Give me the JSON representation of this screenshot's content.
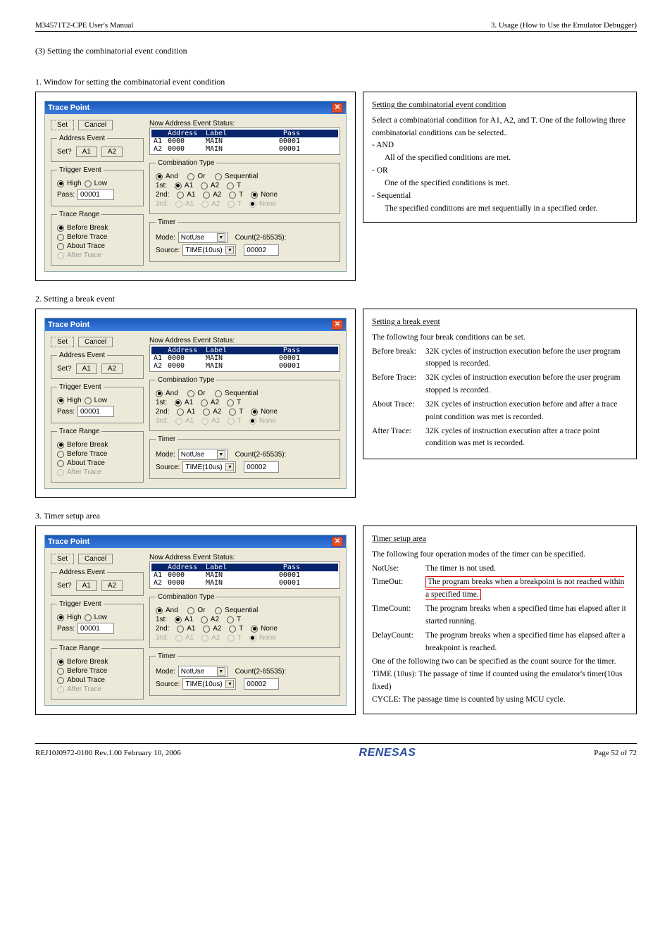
{
  "header": {
    "left": "M34571T2-CPE User's Manual",
    "right": "3. Usage (How to Use the Emulator Debugger)"
  },
  "sect3": "(3) Setting the combinatorial event condition",
  "step1": "1. Window for setting the combinatorial event condition",
  "step2": "2. Setting a break event",
  "step3": "3. Timer setup area",
  "dlg": {
    "title": "Trace Point",
    "set": "Set",
    "cancel": "Cancel",
    "addr_event": "Address Event",
    "setq": "Set?",
    "a1": "A1",
    "a2": "A2",
    "now_status": "Now Address Event Status:",
    "tbl_hdr_addr": "Address",
    "tbl_hdr_lbl": "Label",
    "tbl_hdr_pass": "Pass",
    "rows": [
      {
        "idx": "A1",
        "addr": "0000",
        "lbl": "MAIN",
        "pass": "00001"
      },
      {
        "idx": "A2",
        "addr": "0000",
        "lbl": "MAIN",
        "pass": "00001"
      }
    ],
    "trig_event": "Trigger Event",
    "high": "High",
    "low": "Low",
    "pass": "Pass:",
    "pass_val": "00001",
    "trace_range": "Trace Range",
    "tr_bb": "Before Break",
    "tr_bt": "Before Trace",
    "tr_at": "About Trace",
    "tr_af": "After Trace",
    "combo_type": "Combination Type",
    "and": "And",
    "or": "Or",
    "seq": "Sequential",
    "first": "1st:",
    "second": "2nd:",
    "third": "3rd:",
    "none": "None",
    "t": "T",
    "timer": "Timer",
    "mode": "Mode:",
    "mode_val": "NotUse",
    "count": "Count(2-65535):",
    "source": "Source:",
    "source_val": "TIME(10us)",
    "count_val": "00002"
  },
  "call1": {
    "title": "Setting the combinatorial event condition",
    "para1": "Select a combinatorial condition for A1, A2, and T. One of the following three combinatorial conditions can be selected..",
    "and": "AND",
    "and_d": "All of the specified conditions are met.",
    "or": "OR",
    "or_d": "One of the specified conditions is met.",
    "seq": "Sequential",
    "seq_d": "The specified conditions are met sequentially in a specified order."
  },
  "call2": {
    "title": "Setting a break event",
    "para": "The following four break conditions can be set.",
    "bb_k": "Before break:",
    "bb_v": "32K cycles of instruction execution before the user program stopped is recorded.",
    "bt_k": "Before Trace:",
    "bt_v": "32K cycles of instruction execution before the user program stopped is recorded.",
    "at_k": "About Trace:",
    "at_v": "32K cycles of instruction execution before and after a trace point condition was met is recorded.",
    "af_k": "After Trace:",
    "af_v": "32K cycles of instruction execution after a trace point condition was met is recorded."
  },
  "call3": {
    "title": "Timer setup area",
    "para": "The following four operation modes of the timer can be specified.",
    "nu_k": "NotUse:",
    "nu_v": "The timer is not used.",
    "to_k": "TimeOut:",
    "to_v": "The program breaks when a breakpoint is not reached within a specified time.",
    "tc_k": "TimeCount:",
    "tc_v": "The program breaks when a specified time has elapsed after it started running.",
    "dc_k": "DelayCount:",
    "dc_v": "The program breaks when a specified time has elapsed after a breakpoint is reached.",
    "after": "One of the following two can be specified as the count source for the timer.",
    "time_l": "TIME (10us): The passage of time if counted using the emulator's timer(10us fixed)",
    "cycle_l": "CYCLE:  The passage time is counted by using MCU cycle."
  },
  "footer": {
    "left": "REJ10J0972-0100   Rev.1.00   February 10, 2006",
    "center": "RENESAS",
    "right": "Page 52 of 72"
  }
}
